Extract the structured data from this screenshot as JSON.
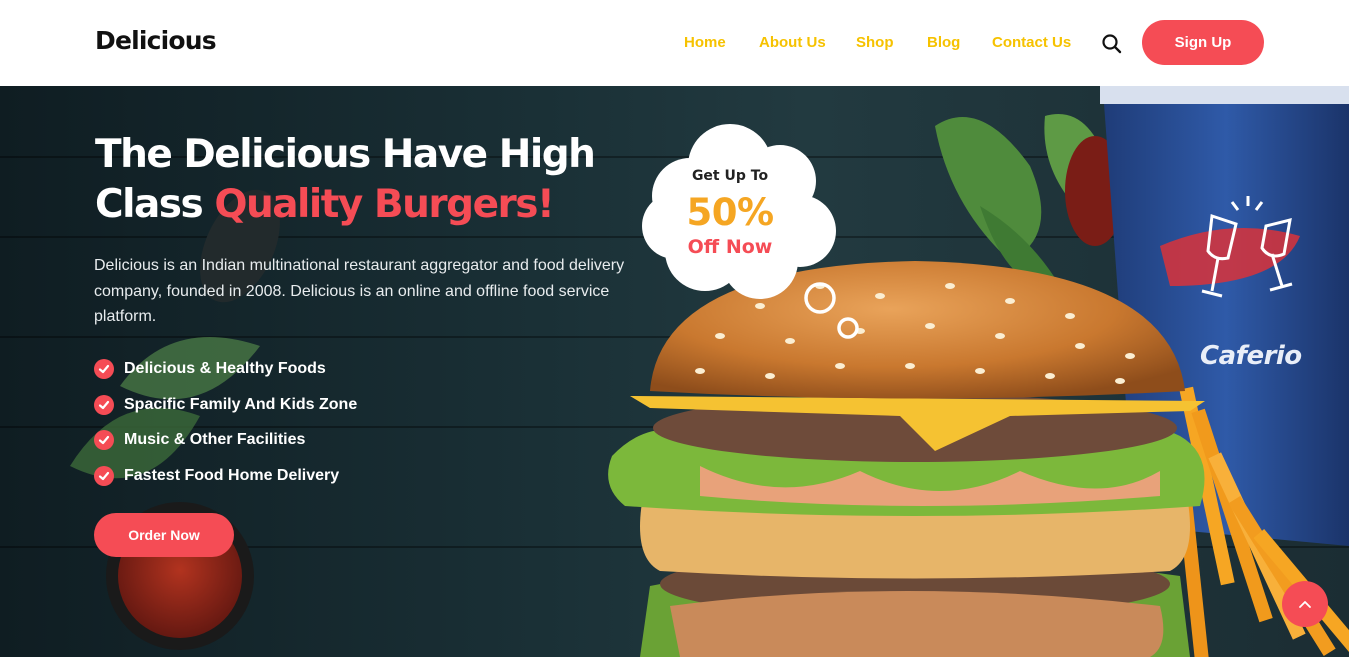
{
  "brand": {
    "logo": "Delicious"
  },
  "nav": {
    "items": [
      {
        "label": "Home"
      },
      {
        "label": "About Us"
      },
      {
        "label": "Shop"
      },
      {
        "label": "Blog"
      },
      {
        "label": "Contact Us"
      }
    ],
    "search_icon": "search-icon",
    "signup_label": "Sign Up"
  },
  "hero": {
    "title_line1": "The Delicious Have High",
    "title_line2_plain": "Class ",
    "title_line2_accent": "Quality Burgers!",
    "description": "Delicious is an Indian multinational restaurant aggregator and food delivery company, founded in 2008. Delicious is an online and offline food service platform.",
    "features": [
      {
        "label": "Delicious & Healthy Foods"
      },
      {
        "label": "Spacific Family And Kids Zone"
      },
      {
        "label": "Music & Other Facilities"
      },
      {
        "label": "Fastest Food Home Delivery"
      }
    ],
    "order_label": "Order Now"
  },
  "promo": {
    "top": "Get Up To",
    "percent": "50%",
    "bottom": "Off Now"
  },
  "cup": {
    "brand": "Caferio"
  },
  "icons": {
    "check": "check-circle-icon",
    "scroll_top": "chevron-up-icon"
  },
  "colors": {
    "accent": "#f54c55",
    "nav": "#f6c200",
    "promo_percent": "#f5a623",
    "hero_bg": "#1a3036"
  }
}
